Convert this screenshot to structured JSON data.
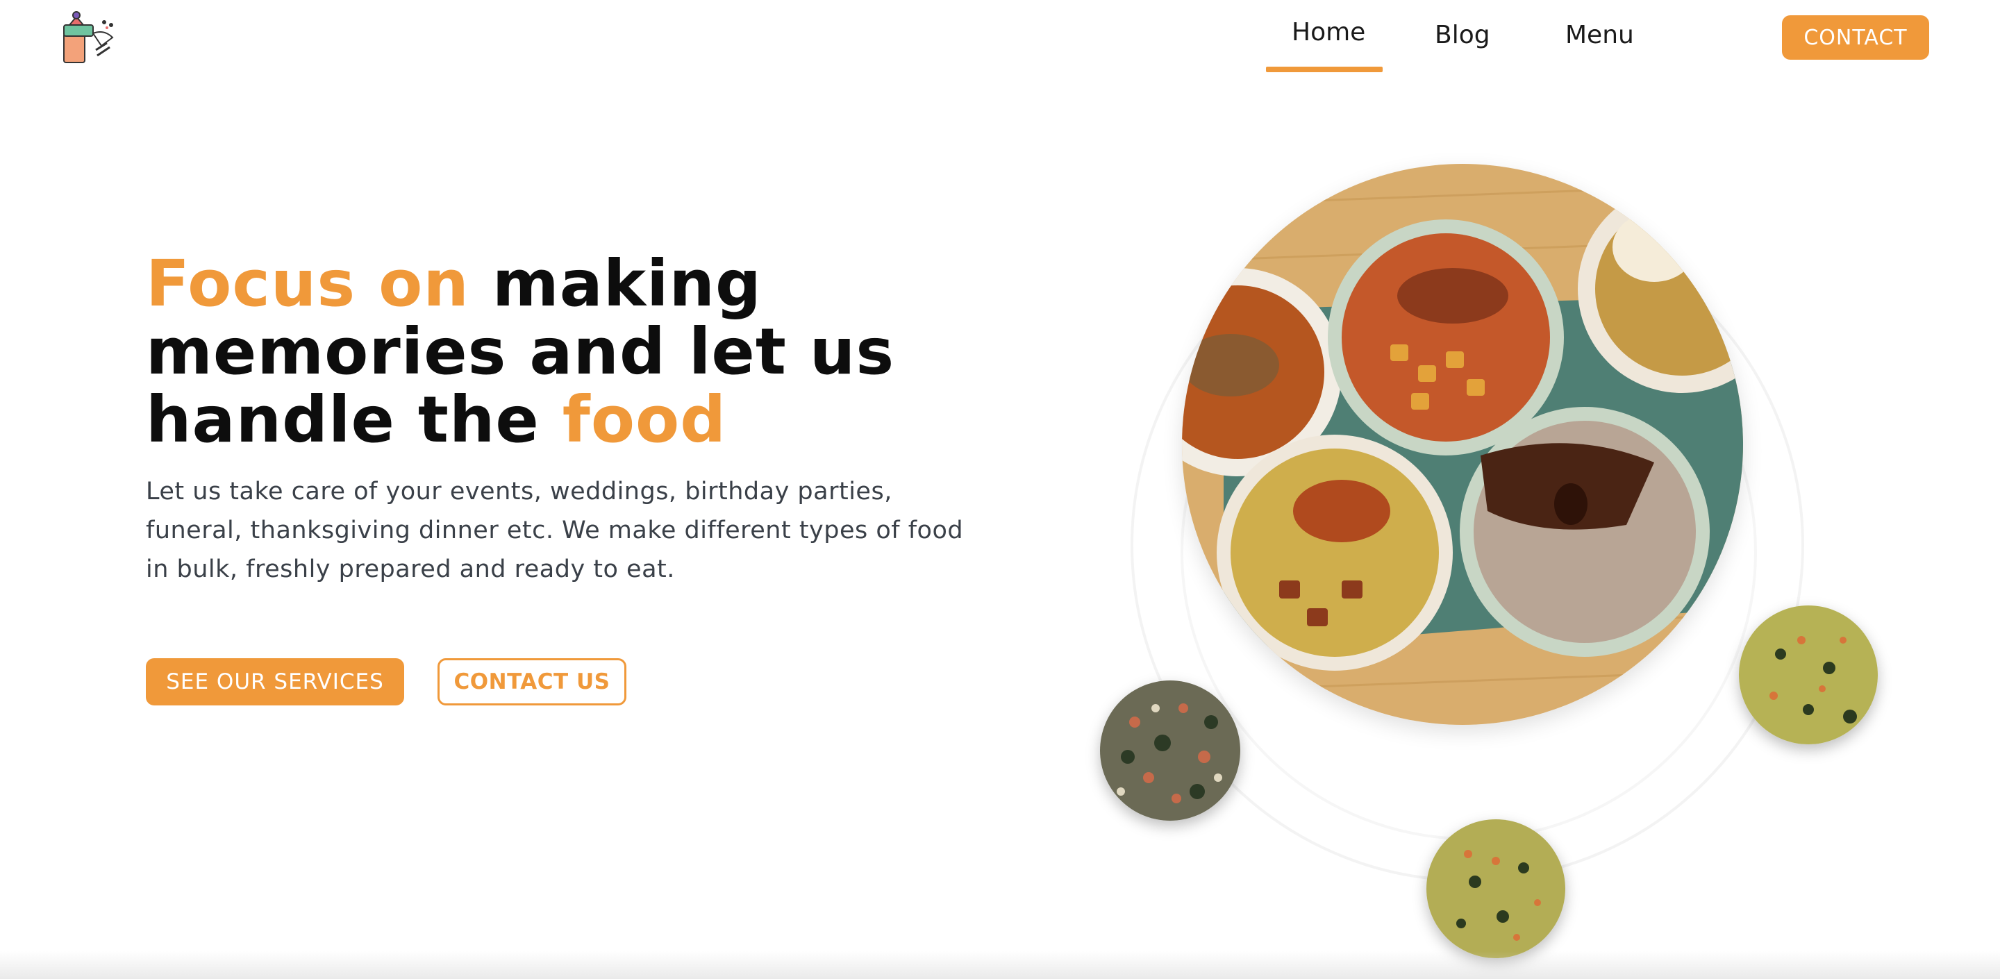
{
  "nav": {
    "items": [
      {
        "label": "Home",
        "active": true
      },
      {
        "label": "Blog",
        "active": false
      },
      {
        "label": "Menu",
        "active": false
      }
    ],
    "contact_label": "CONTACT"
  },
  "hero": {
    "headline": {
      "part1": "Focus on",
      "part2": " making memories and let us handle the ",
      "part3": "food"
    },
    "subtext": "Let us take care of your events, weddings, birthday parties, funeral, thanksgiving dinner etc. We make different types of food in bulk, freshly prepared and ready to eat.",
    "primary_button": "SEE OUR SERVICES",
    "secondary_button": "CONTACT US"
  },
  "colors": {
    "accent": "#f0993a",
    "text": "#0d0d0d",
    "body_text": "#3a4048"
  },
  "icons": {
    "logo": "chef-logo-icon"
  }
}
